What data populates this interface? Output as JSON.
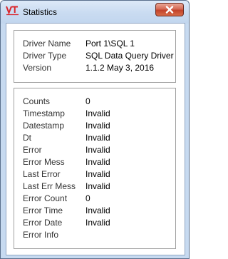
{
  "window": {
    "title": "Statistics",
    "logo_text": "VT",
    "accent_color": "#d9262c"
  },
  "driver_info": {
    "rows": [
      {
        "label": "Driver Name",
        "value": "Port 1\\SQL 1"
      },
      {
        "label": "Driver Type",
        "value": "SQL Data Query Driver"
      },
      {
        "label": "Version",
        "value": "1.1.2 May 3, 2016"
      }
    ]
  },
  "statistics": {
    "rows": [
      {
        "label": "Counts",
        "value": "0"
      },
      {
        "label": "Timestamp",
        "value": "Invalid"
      },
      {
        "label": "Datestamp",
        "value": "Invalid"
      },
      {
        "label": "Dt",
        "value": "Invalid"
      },
      {
        "label": "Error",
        "value": "Invalid"
      },
      {
        "label": "Error Mess",
        "value": "Invalid"
      },
      {
        "label": "Last Error",
        "value": "Invalid"
      },
      {
        "label": "Last Err Mess",
        "value": "Invalid"
      },
      {
        "label": "Error Count",
        "value": "0"
      },
      {
        "label": "Error Time",
        "value": "Invalid"
      },
      {
        "label": "Error Date",
        "value": "Invalid"
      },
      {
        "label": "Error Info",
        "value": ""
      }
    ]
  }
}
